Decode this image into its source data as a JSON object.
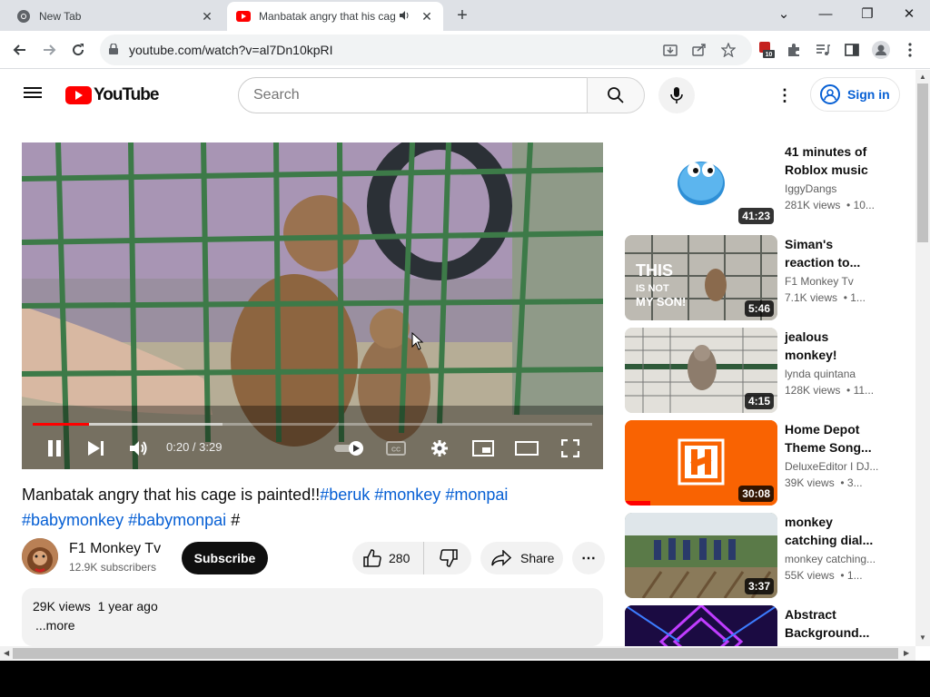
{
  "browser": {
    "tabs": [
      {
        "title": "New Tab",
        "icon": "chrome-icon"
      },
      {
        "title": "Manbatak angry that his cag",
        "icon": "youtube-favicon",
        "audio": true
      }
    ],
    "url": "youtube.com/watch?v=al7Dn10kpRI",
    "extension_badge": "10"
  },
  "youtube": {
    "logo": "YouTube",
    "search_placeholder": "Search",
    "signin_label": "Sign in"
  },
  "player": {
    "current_time": "0:20",
    "duration": "3:29",
    "time_display": "0:20 / 3:29",
    "played_fraction": 0.1,
    "loaded_fraction": 0.34
  },
  "video": {
    "title_text": "Manbatak angry that his cage is painted!!",
    "hashtags": [
      "#beruk",
      "#monkey",
      "#monpai",
      "#babymonkey",
      "#babymonpai"
    ],
    "trailing": "#",
    "channel": "F1 Monkey Tv",
    "subscribers": "12.9K subscribers",
    "subscribe_label": "Subscribe",
    "likes": "280",
    "share_label": "Share",
    "views": "29K views",
    "age": "1 year ago",
    "more_label": "...more"
  },
  "suggestions": [
    {
      "title": "41 minutes of\nRoblox music",
      "channel": "IggyDangs",
      "views": "281K views",
      "age_trunc": "• 10...",
      "duration": "41:23"
    },
    {
      "title": "Siman's\nreaction to...",
      "channel": "F1 Monkey Tv",
      "views": "7.1K views",
      "age_trunc": "• 1...",
      "duration": "5:46"
    },
    {
      "title": "jealous\nmonkey!",
      "channel": "lynda quintana",
      "views": "128K views",
      "age_trunc": "• 11...",
      "duration": "4:15"
    },
    {
      "title": "Home Depot\nTheme Song...",
      "channel": "DeluxeEditor I DJ...",
      "views": "39K views",
      "age_trunc": "• 3...",
      "duration": "30:08"
    },
    {
      "title": "monkey\ncatching dial...",
      "channel": "monkey catching...",
      "views": "55K views",
      "age_trunc": "• 1...",
      "duration": "3:37"
    },
    {
      "title": "Abstract\nBackground...",
      "channel": "",
      "views": "",
      "age_trunc": "",
      "duration": ""
    }
  ],
  "colors": {
    "youtube_red": "#ff0000",
    "link_blue": "#065fd4",
    "home_depot_orange": "#f96302"
  }
}
